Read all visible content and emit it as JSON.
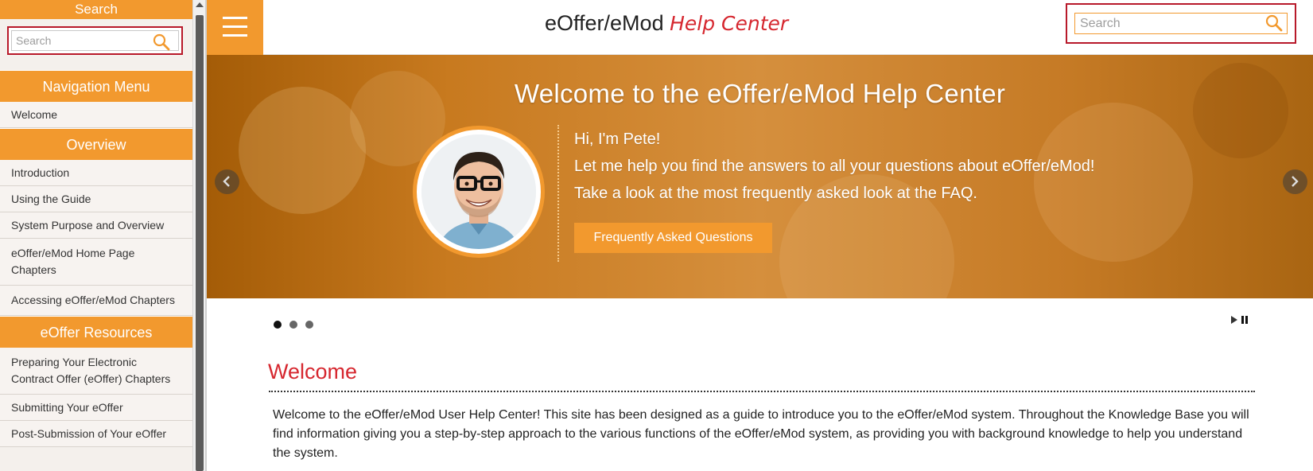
{
  "sidebar": {
    "search_title": "Search",
    "search_placeholder": "Search",
    "sections": [
      {
        "title": "Navigation Menu",
        "items": [
          "Welcome"
        ]
      },
      {
        "title": "Overview",
        "items": [
          "Introduction",
          "Using the Guide",
          "System Purpose and Overview",
          "eOffer/eMod Home Page Chapters",
          "Accessing eOffer/eMod Chapters"
        ]
      },
      {
        "title": "eOffer Resources",
        "items": [
          "Preparing Your Electronic Contract Offer (eOffer) Chapters",
          "Submitting Your eOffer",
          "Post-Submission of Your eOffer"
        ]
      }
    ]
  },
  "header": {
    "title_main": "eOffer/eMod",
    "title_accent": "Help Center",
    "search_placeholder": "Search",
    "menu_icon": "hamburger-icon",
    "search_icon": "magnifier-icon"
  },
  "hero": {
    "title": "Welcome to the eOffer/eMod Help Center",
    "greeting": "Hi, I'm Pete!",
    "line1": "Let me help you find the answers to all your questions about eOffer/eMod!",
    "line2": "Take a look at the most frequently asked look at the FAQ.",
    "button_label": "Frequently Asked Questions",
    "active_slide": 1,
    "slide_count": 3
  },
  "welcome": {
    "heading": "Welcome",
    "body": "Welcome to the eOffer/eMod User Help Center! This site has been designed as a guide to introduce you to the eOffer/eMod system. Throughout the Knowledge Base you will find information giving you a step-by-step approach to the various functions of the eOffer/eMod system, as providing you with background knowledge to help you understand the system."
  },
  "colors": {
    "accent_orange": "#f2992e",
    "accent_red": "#d6272f",
    "highlight_border": "#b8192a"
  }
}
